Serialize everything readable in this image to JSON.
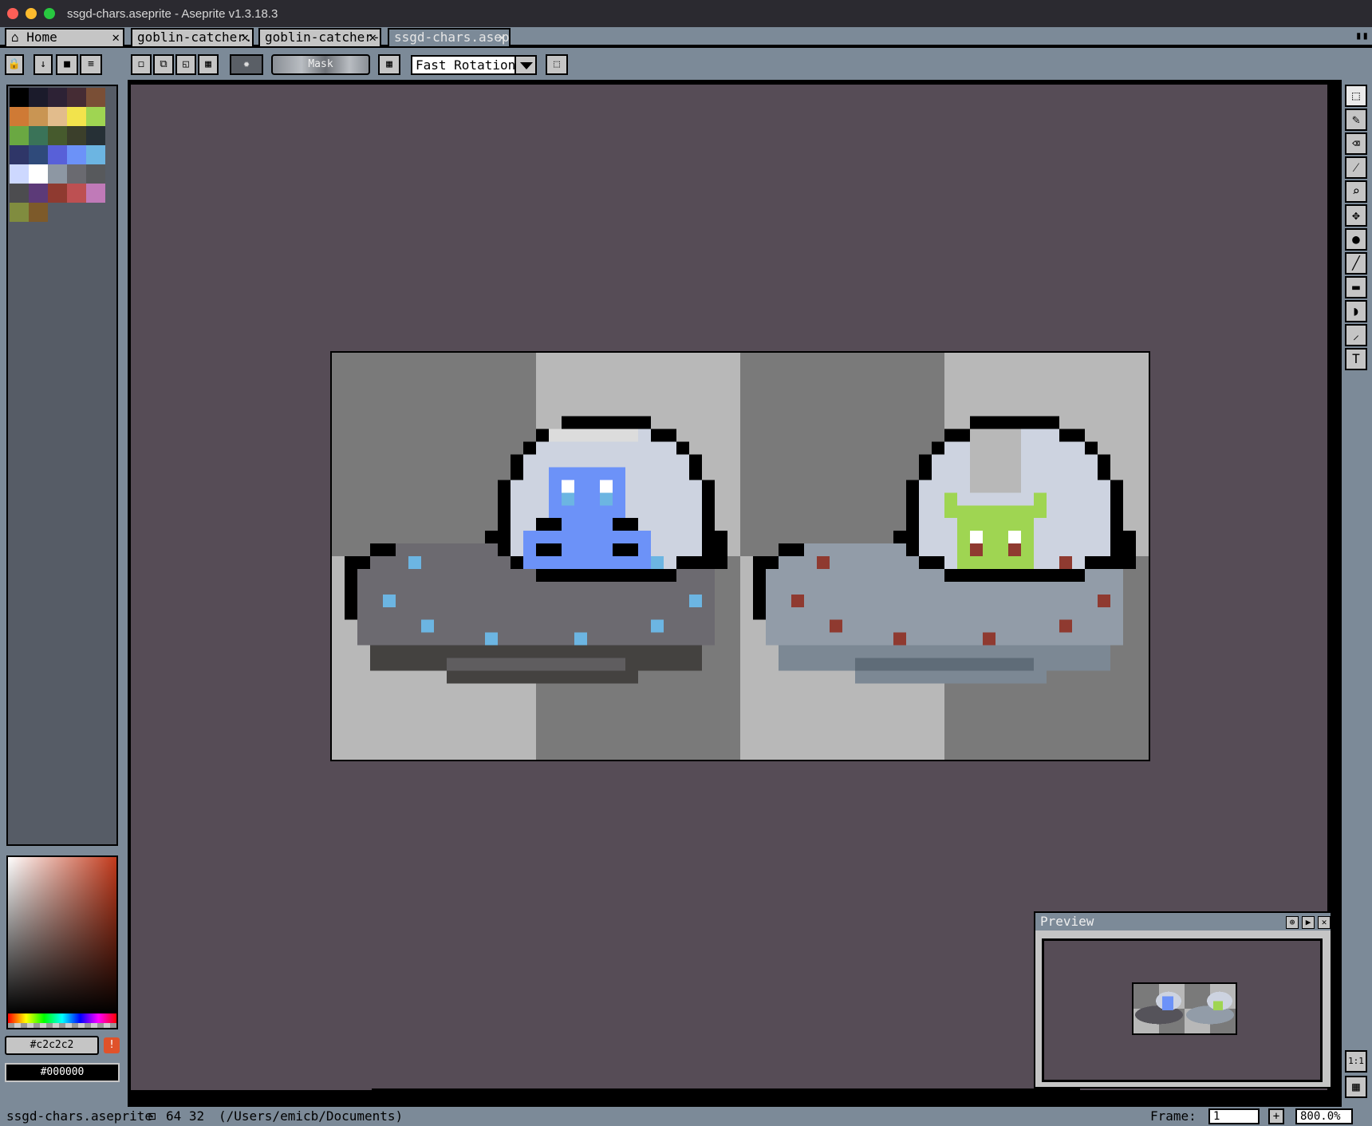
{
  "window": {
    "title": "ssgd-chars.aseprite - Aseprite v1.3.18.3"
  },
  "tabs": [
    {
      "label": "Home"
    },
    {
      "label": "goblin-catcher."
    },
    {
      "label": "goblin-catcher-"
    },
    {
      "label": "ssgd-chars.asep"
    }
  ],
  "toolbar": {
    "mask_label": "Mask",
    "rotation_algorithm": "Fast Rotation"
  },
  "palette": {
    "colors": [
      "#000000",
      "#1b1b2b",
      "#2d2235",
      "#452c34",
      "#7a4f36",
      "#cf7a35",
      "#c99553",
      "#e2bc8c",
      "#f2e34c",
      "#9fd552",
      "#6aa842",
      "#3a7358",
      "#465a2d",
      "#3b3f2b",
      "#263036",
      "#2f3668",
      "#2f4a7a",
      "#5860d8",
      "#6c92f8",
      "#6cb5e2",
      "#cdd8ff",
      "#ffffff",
      "#8d97a3",
      "#6a6a70",
      "#57595c",
      "#4c4c4f",
      "#5c3a78",
      "#8f3a30",
      "#bd5052",
      "#c07ab8",
      "#808c3f",
      "#7d5a2a"
    ]
  },
  "colors": {
    "foreground_hex": "#c2c2c2",
    "background_hex": "#000000"
  },
  "preview": {
    "title": "Preview"
  },
  "status": {
    "filename": "ssgd-chars.aseprite",
    "size": "64 32",
    "path": "(/Users/emicb/Documents)",
    "frame_label": "Frame:",
    "frame_value": "1",
    "zoom": "800.0%"
  }
}
